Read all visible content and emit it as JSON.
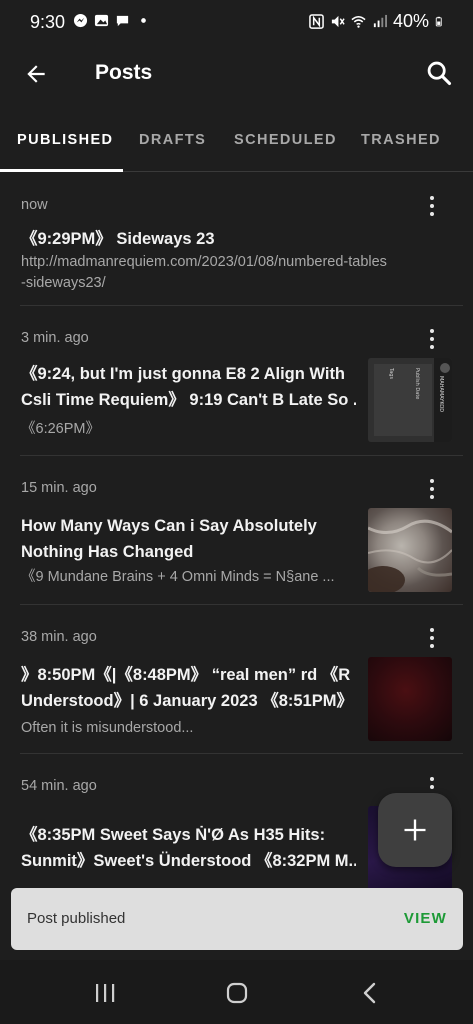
{
  "status_bar": {
    "time": "9:30",
    "battery": "40%",
    "icons": [
      "messenger-icon",
      "gallery-icon",
      "chat-icon",
      "dot-icon",
      "nfc-icon",
      "mute-icon",
      "wifi-icon",
      "signal-icon",
      "battery-icon"
    ]
  },
  "app_bar": {
    "title": "Posts",
    "back_icon": "arrow-left-icon",
    "search_icon": "search-icon"
  },
  "tabs": [
    {
      "label": "PUBLISHED",
      "active": true
    },
    {
      "label": "DRAFTS",
      "active": false
    },
    {
      "label": "SCHEDULED",
      "active": false
    },
    {
      "label": "TRASHED",
      "active": false
    }
  ],
  "posts": [
    {
      "time": "now",
      "title": "《9:29PM》 Sideways 23",
      "excerpt": "http://madmanrequiem.com/2023/01/08/numbered-tables-sideways23/",
      "excerpt_lines": [
        "http://madmanrequiem.com/2023/01/08/numbered-tables",
        "-sideways23/"
      ],
      "has_thumbnail": false
    },
    {
      "time": "3 min. ago",
      "title": "《9:24, but I'm just gonna E8 2 Align With Csli Time Requiem》 9:19 Can't B Late So ...",
      "title_lines": [
        "《9:24, but I'm just gonna E8 2 Align With",
        "Csli Time Requiem》 9:19 Can't B Late So ..."
      ],
      "excerpt": "《6:26PM》",
      "has_thumbnail": true,
      "thumb_text": [
        "Publish Date",
        "Tags",
        "MAHAMAYKOD"
      ]
    },
    {
      "time": "15 min. ago",
      "title": "How Many Ways Can i Say Absolutely Nothing Has Changed",
      "title_lines": [
        "How Many Ways Can i Say Absolutely",
        "Nothing Has Changed"
      ],
      "excerpt": "《9 Mundane Brains + 4 Omni Minds = N§ane ...",
      "has_thumbnail": true
    },
    {
      "time": "38 min. ago",
      "title": "》8:50PM《|《8:48PM》 “real men” rd 《R Understood》| 6 January 2023 《8:51PM》",
      "title_lines": [
        "》8:50PM《|《8:48PM》 “real men” rd 《R",
        "Understood》| 6 January 2023 《8:51PM》"
      ],
      "excerpt": "Often it is misunderstood...",
      "has_thumbnail": true
    },
    {
      "time": "54 min. ago",
      "title": "《8:35PM Sweet Says Ṅ'Ø As H35 Hits: Sunmit》Sweet's Ünderstood 《8:32PM M...",
      "title_lines": [
        "《8:35PM Sweet Says Ṅ'Ø As H35 Hits:",
        "Sunmit》Sweet's Ünderstood 《8:32PM M..."
      ],
      "has_thumbnail": true
    }
  ],
  "fab": {
    "icon": "plus-icon"
  },
  "snackbar": {
    "message": "Post published",
    "action": "VIEW",
    "action_color": "#1d9a36"
  },
  "nav_bar": {
    "icons": [
      "recents-icon",
      "home-icon",
      "back-nav-icon"
    ]
  },
  "colors": {
    "background": "#1e1e1e",
    "text_primary": "#f2f2f2",
    "text_secondary": "#a8a8a8"
  }
}
